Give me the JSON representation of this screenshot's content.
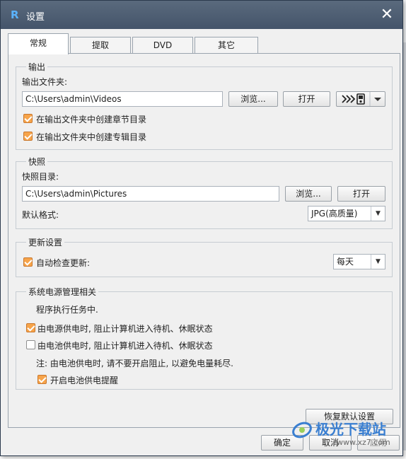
{
  "dialog": {
    "title": "设置",
    "close_glyph": "✕"
  },
  "tabs": [
    {
      "label": "常规",
      "active": true
    },
    {
      "label": "提取",
      "active": false
    },
    {
      "label": "DVD",
      "active": false
    },
    {
      "label": "其它",
      "active": false
    }
  ],
  "output": {
    "group_title": "输出",
    "folder_label": "输出文件夹:",
    "folder_value": "C:\\Users\\admin\\Videos",
    "browse_label": "浏览...",
    "open_label": "打开",
    "device_icon": "device-export-icon",
    "chapter_dir_label": "在输出文件夹中创建章节目录",
    "chapter_dir_checked": true,
    "album_dir_label": "在输出文件夹中创建专辑目录",
    "album_dir_checked": true
  },
  "snapshot": {
    "group_title": "快照",
    "dir_label": "快照目录:",
    "dir_value": "C:\\Users\\admin\\Pictures",
    "browse_label": "浏览...",
    "open_label": "打开",
    "format_label": "默认格式:",
    "format_value": "JPG(高质量)"
  },
  "update": {
    "group_title": "更新设置",
    "auto_check_label": "自动检查更新:",
    "auto_check_checked": true,
    "frequency_value": "每天"
  },
  "power": {
    "group_title": "系统电源管理相关",
    "status_text": "程序执行任务中.",
    "ac_label": "由电源供电时, 阻止计算机进入待机、休眠状态",
    "ac_checked": true,
    "battery_label": "由电池供电时, 阻止计算机进入待机、休眠状态",
    "battery_checked": false,
    "note_text": "注: 由电池供电时, 请不要开启阻止, 以避免电量耗尽.",
    "reminder_label": "开启电池供电提醒",
    "reminder_checked": true
  },
  "footer": {
    "restore_label": "恢复默认设置",
    "ok_label": "确定",
    "cancel_label": "取消",
    "apply_label": "应用"
  },
  "watermark": {
    "brand": "极光下载站",
    "url": "www.xz7.com"
  },
  "colors": {
    "titlebar": "#4a5a6f",
    "checkbox_checked": "#f7a44a",
    "watermark": "#3a7fd1"
  }
}
